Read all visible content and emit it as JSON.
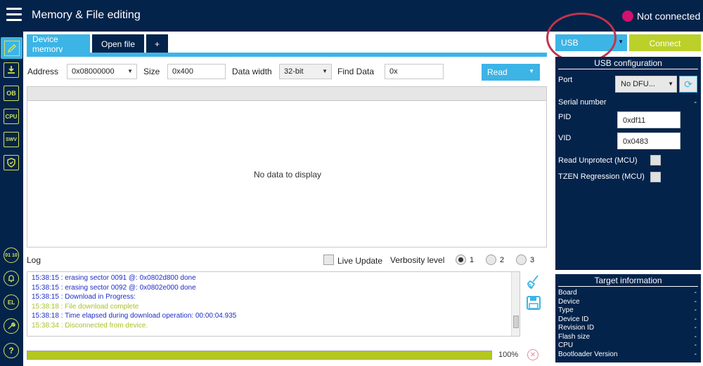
{
  "header": {
    "title": "Memory & File editing",
    "connection_status": "Not connected",
    "status_color": "#d2126e"
  },
  "sidebar": {
    "items": [
      {
        "name": "memory-edit",
        "icon": "pencil-icon"
      },
      {
        "name": "erasing-programming",
        "icon": "download-icon"
      },
      {
        "name": "option-bytes",
        "label": "OB"
      },
      {
        "name": "cpu",
        "label": "CPU"
      },
      {
        "name": "swv",
        "label": "SWV"
      },
      {
        "name": "security",
        "icon": "shield-icon"
      }
    ],
    "bottom_items": [
      {
        "name": "binary",
        "label": "01 10"
      },
      {
        "name": "alarm",
        "icon": "bell-icon"
      },
      {
        "name": "el",
        "label": "EL"
      },
      {
        "name": "settings",
        "icon": "wrench-icon"
      },
      {
        "name": "help",
        "label": "?"
      }
    ]
  },
  "tabs": {
    "device_memory": "Device memory",
    "open_file": "Open file",
    "add": "+"
  },
  "toolbar": {
    "address_label": "Address",
    "address_value": "0x08000000",
    "size_label": "Size",
    "size_value": "0x400",
    "data_width_label": "Data width",
    "data_width_value": "32-bit",
    "find_data_label": "Find Data",
    "find_data_value": "0x",
    "read_label": "Read"
  },
  "data_panel": {
    "empty_text": "No data to display"
  },
  "log": {
    "label": "Log",
    "live_update_label": "Live Update",
    "verbosity_label": "Verbosity level",
    "verbosity_options": [
      "1",
      "2",
      "3"
    ],
    "verbosity_selected": "1",
    "lines": [
      {
        "text": "15:38:15 : erasing sector 0091 @: 0x0802d800 done",
        "color": "blue"
      },
      {
        "text": "15:38:15 : erasing sector 0092 @: 0x0802e000 done",
        "color": "blue"
      },
      {
        "text": "15:38:15 : Download in Progress:",
        "color": "blue"
      },
      {
        "text": "15:38:18 : File download complete",
        "color": "green"
      },
      {
        "text": "15:38:18 : Time elapsed during download operation: 00:00:04.935",
        "color": "blue"
      },
      {
        "text": "15:38:34 : Disconnected from device.",
        "color": "green"
      }
    ]
  },
  "progress": {
    "percent": 100,
    "text": "100%"
  },
  "connection": {
    "interface": "USB",
    "connect_label": "Connect",
    "connect_color": "#bcd02a"
  },
  "usb_config": {
    "title": "USB configuration",
    "port_label": "Port",
    "port_value": "No DFU...",
    "serial_label": "Serial number",
    "serial_value": "-",
    "pid_label": "PID",
    "pid_value": "0xdf11",
    "vid_label": "VID",
    "vid_value": "0x0483",
    "read_unprotect_label": "Read Unprotect (MCU)",
    "tzen_label": "TZEN Regression (MCU)"
  },
  "target_info": {
    "title": "Target information",
    "rows": [
      {
        "label": "Board",
        "value": "-"
      },
      {
        "label": "Device",
        "value": "-"
      },
      {
        "label": "Type",
        "value": "-"
      },
      {
        "label": "Device ID",
        "value": "-"
      },
      {
        "label": "Revision ID",
        "value": "-"
      },
      {
        "label": "Flash size",
        "value": "-"
      },
      {
        "label": "CPU",
        "value": "-"
      },
      {
        "label": "Bootloader Version",
        "value": "-"
      }
    ]
  }
}
